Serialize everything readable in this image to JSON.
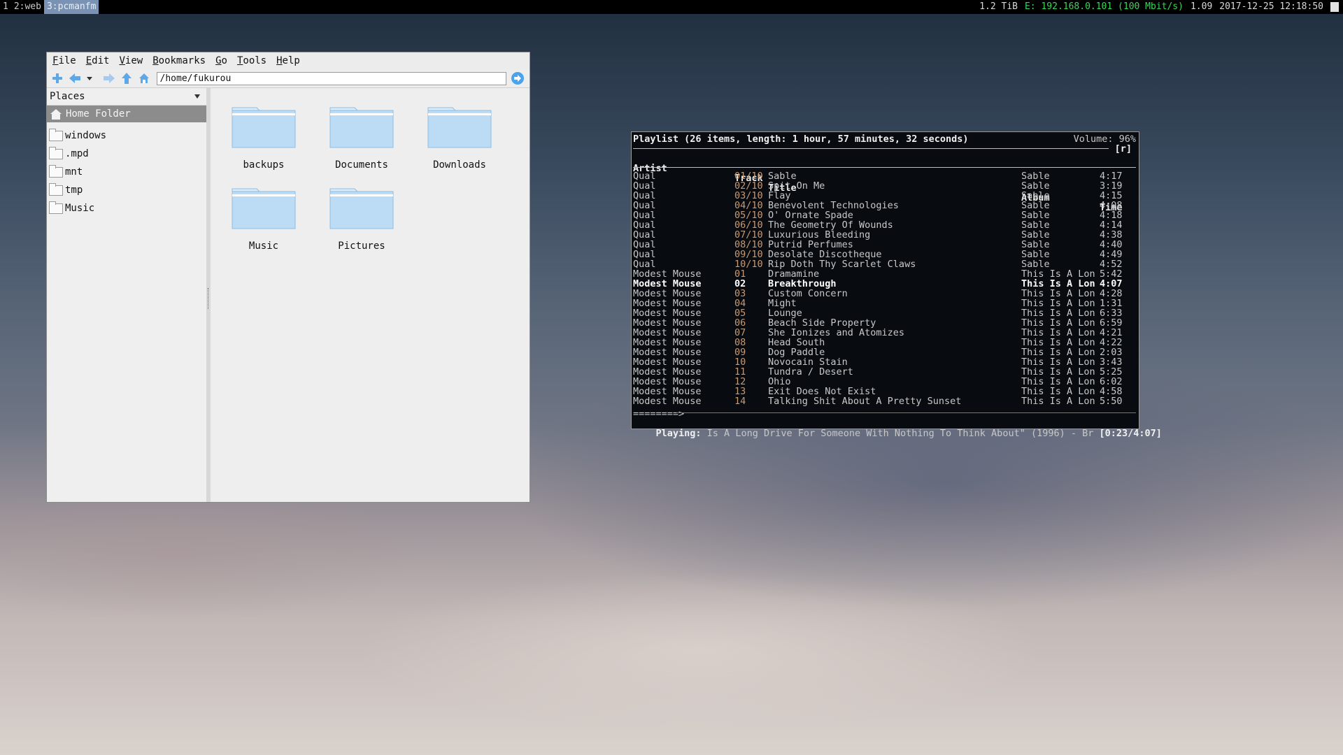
{
  "topbar": {
    "workspaces": [
      {
        "label": "1",
        "active": false
      },
      {
        "label": "2:web",
        "active": false
      },
      {
        "label": "3:pcmanfm",
        "active": true
      }
    ],
    "disk": "1.2 TiB",
    "network": "E: 192.168.0.101 (100 Mbit/s)",
    "load": "1.09",
    "datetime": "2017-12-25 12:18:50"
  },
  "filemanager": {
    "menu": [
      "File",
      "Edit",
      "View",
      "Bookmarks",
      "Go",
      "Tools",
      "Help"
    ],
    "path": "/home/fukurou",
    "places_label": "Places",
    "home_folder": "Home Folder",
    "sidebar_dirs": [
      "windows",
      ".mpd",
      "mnt",
      "tmp",
      "Music"
    ],
    "folders": [
      "backups",
      "Documents",
      "Downloads",
      "Music",
      "Pictures"
    ]
  },
  "ncmpc": {
    "header": "Playlist (26 items, length: 1 hour, 57 minutes, 32 seconds)",
    "volume": "Volume: 96%",
    "flags": "[r]",
    "columns": {
      "artist": "Artist",
      "track": "Track",
      "title": "Title",
      "album": "Album",
      "time": "Time"
    },
    "rows": [
      {
        "artist": "Qual",
        "track": "01/10",
        "title": "Sable",
        "album": "Sable",
        "time": "4:17"
      },
      {
        "artist": "Qual",
        "track": "02/10",
        "title": "Spit On Me",
        "album": "Sable",
        "time": "3:19"
      },
      {
        "artist": "Qual",
        "track": "03/10",
        "title": "Flay",
        "album": "Sable",
        "time": "4:15"
      },
      {
        "artist": "Qual",
        "track": "04/10",
        "title": "Benevolent Technologies",
        "album": "Sable",
        "time": "4:08"
      },
      {
        "artist": "Qual",
        "track": "05/10",
        "title": "O' Ornate Spade",
        "album": "Sable",
        "time": "4:18"
      },
      {
        "artist": "Qual",
        "track": "06/10",
        "title": "The Geometry Of Wounds",
        "album": "Sable",
        "time": "4:14"
      },
      {
        "artist": "Qual",
        "track": "07/10",
        "title": "Luxurious Bleeding",
        "album": "Sable",
        "time": "4:38"
      },
      {
        "artist": "Qual",
        "track": "08/10",
        "title": "Putrid Perfumes",
        "album": "Sable",
        "time": "4:40"
      },
      {
        "artist": "Qual",
        "track": "09/10",
        "title": "Desolate Discotheque",
        "album": "Sable",
        "time": "4:49"
      },
      {
        "artist": "Qual",
        "track": "10/10",
        "title": "Rip Doth Thy Scarlet Claws",
        "album": "Sable",
        "time": "4:52"
      },
      {
        "artist": "Modest Mouse",
        "track": "01",
        "title": "Dramamine",
        "album": "This Is A Lon",
        "time": "5:42"
      },
      {
        "artist": "Modest Mouse",
        "track": "02",
        "title": "Breakthrough",
        "album": "This Is A Lon",
        "time": "4:07",
        "playing": true
      },
      {
        "artist": "Modest Mouse",
        "track": "03",
        "title": "Custom Concern",
        "album": "This Is A Lon",
        "time": "4:28"
      },
      {
        "artist": "Modest Mouse",
        "track": "04",
        "title": "Might",
        "album": "This Is A Lon",
        "time": "1:31"
      },
      {
        "artist": "Modest Mouse",
        "track": "05",
        "title": "Lounge",
        "album": "This Is A Lon",
        "time": "6:33"
      },
      {
        "artist": "Modest Mouse",
        "track": "06",
        "title": "Beach Side Property",
        "album": "This Is A Lon",
        "time": "6:59"
      },
      {
        "artist": "Modest Mouse",
        "track": "07",
        "title": "She Ionizes and Atomizes",
        "album": "This Is A Lon",
        "time": "4:21"
      },
      {
        "artist": "Modest Mouse",
        "track": "08",
        "title": "Head South",
        "album": "This Is A Lon",
        "time": "4:22"
      },
      {
        "artist": "Modest Mouse",
        "track": "09",
        "title": "Dog Paddle",
        "album": "This Is A Lon",
        "time": "2:03"
      },
      {
        "artist": "Modest Mouse",
        "track": "10",
        "title": "Novocain Stain",
        "album": "This Is A Lon",
        "time": "3:43"
      },
      {
        "artist": "Modest Mouse",
        "track": "11",
        "title": "Tundra / Desert",
        "album": "This Is A Lon",
        "time": "5:25"
      },
      {
        "artist": "Modest Mouse",
        "track": "12",
        "title": "Ohio",
        "album": "This Is A Lon",
        "time": "6:02"
      },
      {
        "artist": "Modest Mouse",
        "track": "13",
        "title": "Exit Does Not Exist",
        "album": "This Is A Lon",
        "time": "4:58"
      },
      {
        "artist": "Modest Mouse",
        "track": "14",
        "title": "Talking Shit About A Pretty Sunset",
        "album": "This Is A Lon",
        "time": "5:50"
      }
    ],
    "progress_bar": "========>",
    "playing_label": "Playing:",
    "playing_text": " Is A Long Drive For Someone With Nothing To Think About\" (1996) - Br ",
    "playing_time": "[0:23/4:07]",
    "colors": {
      "track": "#c49a77",
      "net": "#38d65a",
      "folder": "#bcdcf5"
    }
  }
}
